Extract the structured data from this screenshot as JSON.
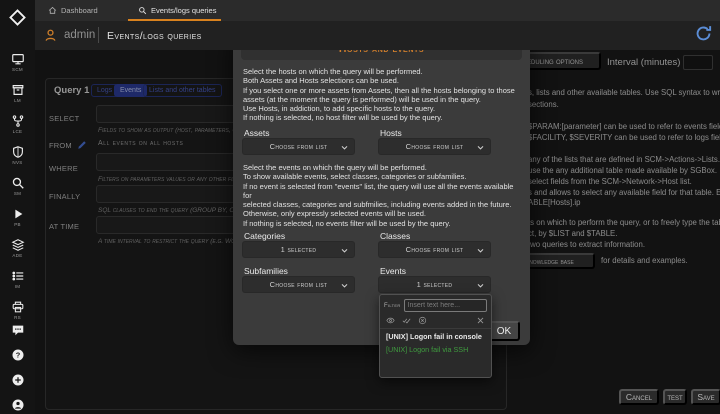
{
  "colors": {
    "accent_orange": "#d9821e",
    "modal_title_orange": "#cc7c2c",
    "tab_blue": "#2b3c96",
    "selected_event_green": "#3f9b3f",
    "refresh_blue": "#5b8dd6"
  },
  "topnav": {
    "tabs": [
      {
        "label": "Dashboard"
      },
      {
        "label": "Events/logs queries"
      }
    ]
  },
  "header": {
    "user": "admin",
    "title": "Events/logs queries"
  },
  "sidebar": {
    "items": [
      {
        "label": "SCM"
      },
      {
        "label": "LM"
      },
      {
        "label": "LCE"
      },
      {
        "label": "NVS"
      },
      {
        "label": "SM"
      },
      {
        "label": "PB"
      },
      {
        "label": "ADE"
      },
      {
        "label": "IM"
      },
      {
        "label": "RS"
      }
    ]
  },
  "query_panel": {
    "title": "Query 1",
    "tabs": {
      "logs": "Logs",
      "events": "Events",
      "lists": "Lists and other tables"
    },
    "active_tab": "Events",
    "rows": {
      "select": {
        "label": "SELECT",
        "hint": "Fields to show as output (host, parameters, operation"
      },
      "from": {
        "label": "FROM",
        "value": "All events on all hosts"
      },
      "where": {
        "label": "WHERE",
        "hint": "Filters on parameters values or any other field"
      },
      "finally": {
        "label": "FINALLY",
        "hint": "SQL clauses to end the query (GROUP BY, ORDER"
      },
      "attime": {
        "label": "AT TIME",
        "hint": "A time interval to restrict the query (e.g. Working H"
      }
    }
  },
  "right_panel": {
    "scheduling_button": "Scheduling options",
    "interval_label": "Interval (minutes)",
    "help_lines": [
      "s, lists and other available tables. Use SQL syntax to write query",
      "sections.",
      "$PARAM:[parameter] can be used to refer to events fields.",
      "$FACILITY, $SEVERITY can be used to refer to logs fields.",
      "any of the lists that are defined in SCM->Actions->Lists.",
      "use the any additional table made available by SGBox.",
      "select fields from the SCM->Network->Host list.",
      "s and allows to select any available field for that table. E.g.",
      "ABLE[Hosts].ip",
      "ts on which to perform the query, or to freely type the table from",
      "ct, by $LIST and $TABLE.",
      "two queries to extract information."
    ],
    "kb_button": "Knowledge base",
    "kb_suffix": "for details and examples."
  },
  "modal": {
    "title": "Hosts and events",
    "para1": [
      "Select the hosts on which the query will be performed.",
      "Both Assets and Hosts selections can be used.",
      "If you select one or more assets from Assets, then all the hosts belonging to those",
      "assets (at the moment the query is performed) will be used in the query.",
      "Use Hosts, in addiction, to add specific hosts to the query.",
      "If nothing is selected, no host filter will be used by the query."
    ],
    "para2": [
      "Select the events on which the query will be performed.",
      "To show available events, select classes, categories or subfamilies.",
      "If no event is selected from \"events\" list, the query will use all the events available for",
      "selected classes, categories and subfmilies, including events added in the future.",
      "Otherwise, only expressly selected events will be used.",
      "If nothing is selected, no events filter will be used by the query."
    ],
    "fields": {
      "assets": {
        "label": "Assets",
        "value": "Choose from list"
      },
      "hosts": {
        "label": "Hosts",
        "value": "Choose from list"
      },
      "categories": {
        "label": "Categories",
        "value": "1 selected"
      },
      "classes": {
        "label": "Classes",
        "value": "Choose from list"
      },
      "subfamilies": {
        "label": "Subfamilies",
        "value": "Choose from list"
      },
      "events": {
        "label": "Events",
        "value": "1 selected"
      }
    },
    "events_panel": {
      "filter_label": "Filter",
      "filter_placeholder": "Insert text here...",
      "items": [
        {
          "text": "[UNIX] Logon fail in console",
          "selected": false
        },
        {
          "text": "[UNIX] Logon fail via SSH",
          "selected": true
        }
      ]
    },
    "ok_label": "OK"
  },
  "footer": {
    "cancel": "Cancel",
    "test": "test",
    "save": "Save"
  }
}
